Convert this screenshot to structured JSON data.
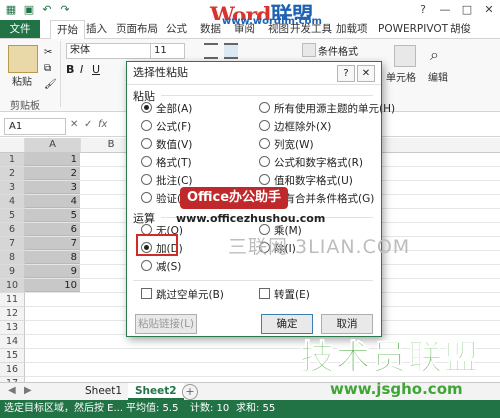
{
  "watermark": {
    "word_part1": "Word",
    "word_part2": "联盟",
    "word_url": "www.wordlm.com",
    "banner": "Office办公助手",
    "banner_url": "www.officezhushou.com",
    "sanlian": "三联网 3LIAN.COM",
    "jishu": "技术员联盟",
    "jsgho": "www.jsgho.com"
  },
  "quick_access": {
    "help": "?",
    "minimize": "—",
    "restore": "□",
    "close": "✕"
  },
  "tabs": [
    "文件",
    "开始",
    "插入",
    "页面布局",
    "公式",
    "数据",
    "审阅",
    "视图",
    "开发工具",
    "加载项",
    "POWERPIVOT",
    "胡俊"
  ],
  "ribbon": {
    "paste_label": "粘贴",
    "clipboard_label": "剪贴板",
    "font_name": "宋体",
    "font_size": "11",
    "conditional_format": "条件格式",
    "cell_label": "单元格",
    "edit_label": "编辑"
  },
  "formula_bar": {
    "name_box": "A1",
    "cancel": "✕",
    "enter": "✓",
    "fx": "fx"
  },
  "grid": {
    "columns": [
      "A",
      "B"
    ],
    "rows": [
      "1",
      "2",
      "3",
      "4",
      "5",
      "6",
      "7",
      "8",
      "9",
      "10",
      "11",
      "12",
      "13",
      "14",
      "15",
      "16",
      "17"
    ],
    "values": [
      "1",
      "2",
      "3",
      "4",
      "5",
      "6",
      "7",
      "8",
      "9",
      "10"
    ]
  },
  "sheets": {
    "tab1": "Sheet1",
    "tab2": "Sheet2"
  },
  "statusbar": {
    "message": "选定目标区域，然后按 E...",
    "average": "平均值: 5.5",
    "count": "计数: 10",
    "sum": "求和: 55"
  },
  "dialog": {
    "title": "选择性粘贴",
    "paste_section": "粘贴",
    "paste_options_left": [
      "全部(A)",
      "公式(F)",
      "数值(V)",
      "格式(T)",
      "批注(C)",
      "验证(N)"
    ],
    "paste_options_right": [
      "所有使用源主题的单元(H)",
      "边框除外(X)",
      "列宽(W)",
      "公式和数字格式(R)",
      "值和数字格式(U)",
      "所有合并条件格式(G)"
    ],
    "operation_section": "运算",
    "operation_left": [
      "无(O)",
      "加(D)",
      "减(S)"
    ],
    "operation_right": [
      "乘(M)",
      "除(I)"
    ],
    "skip_blanks": "跳过空单元(B)",
    "transpose": "转置(E)",
    "paste_link": "粘贴链接(L)",
    "ok": "确定",
    "cancel": "取消"
  }
}
